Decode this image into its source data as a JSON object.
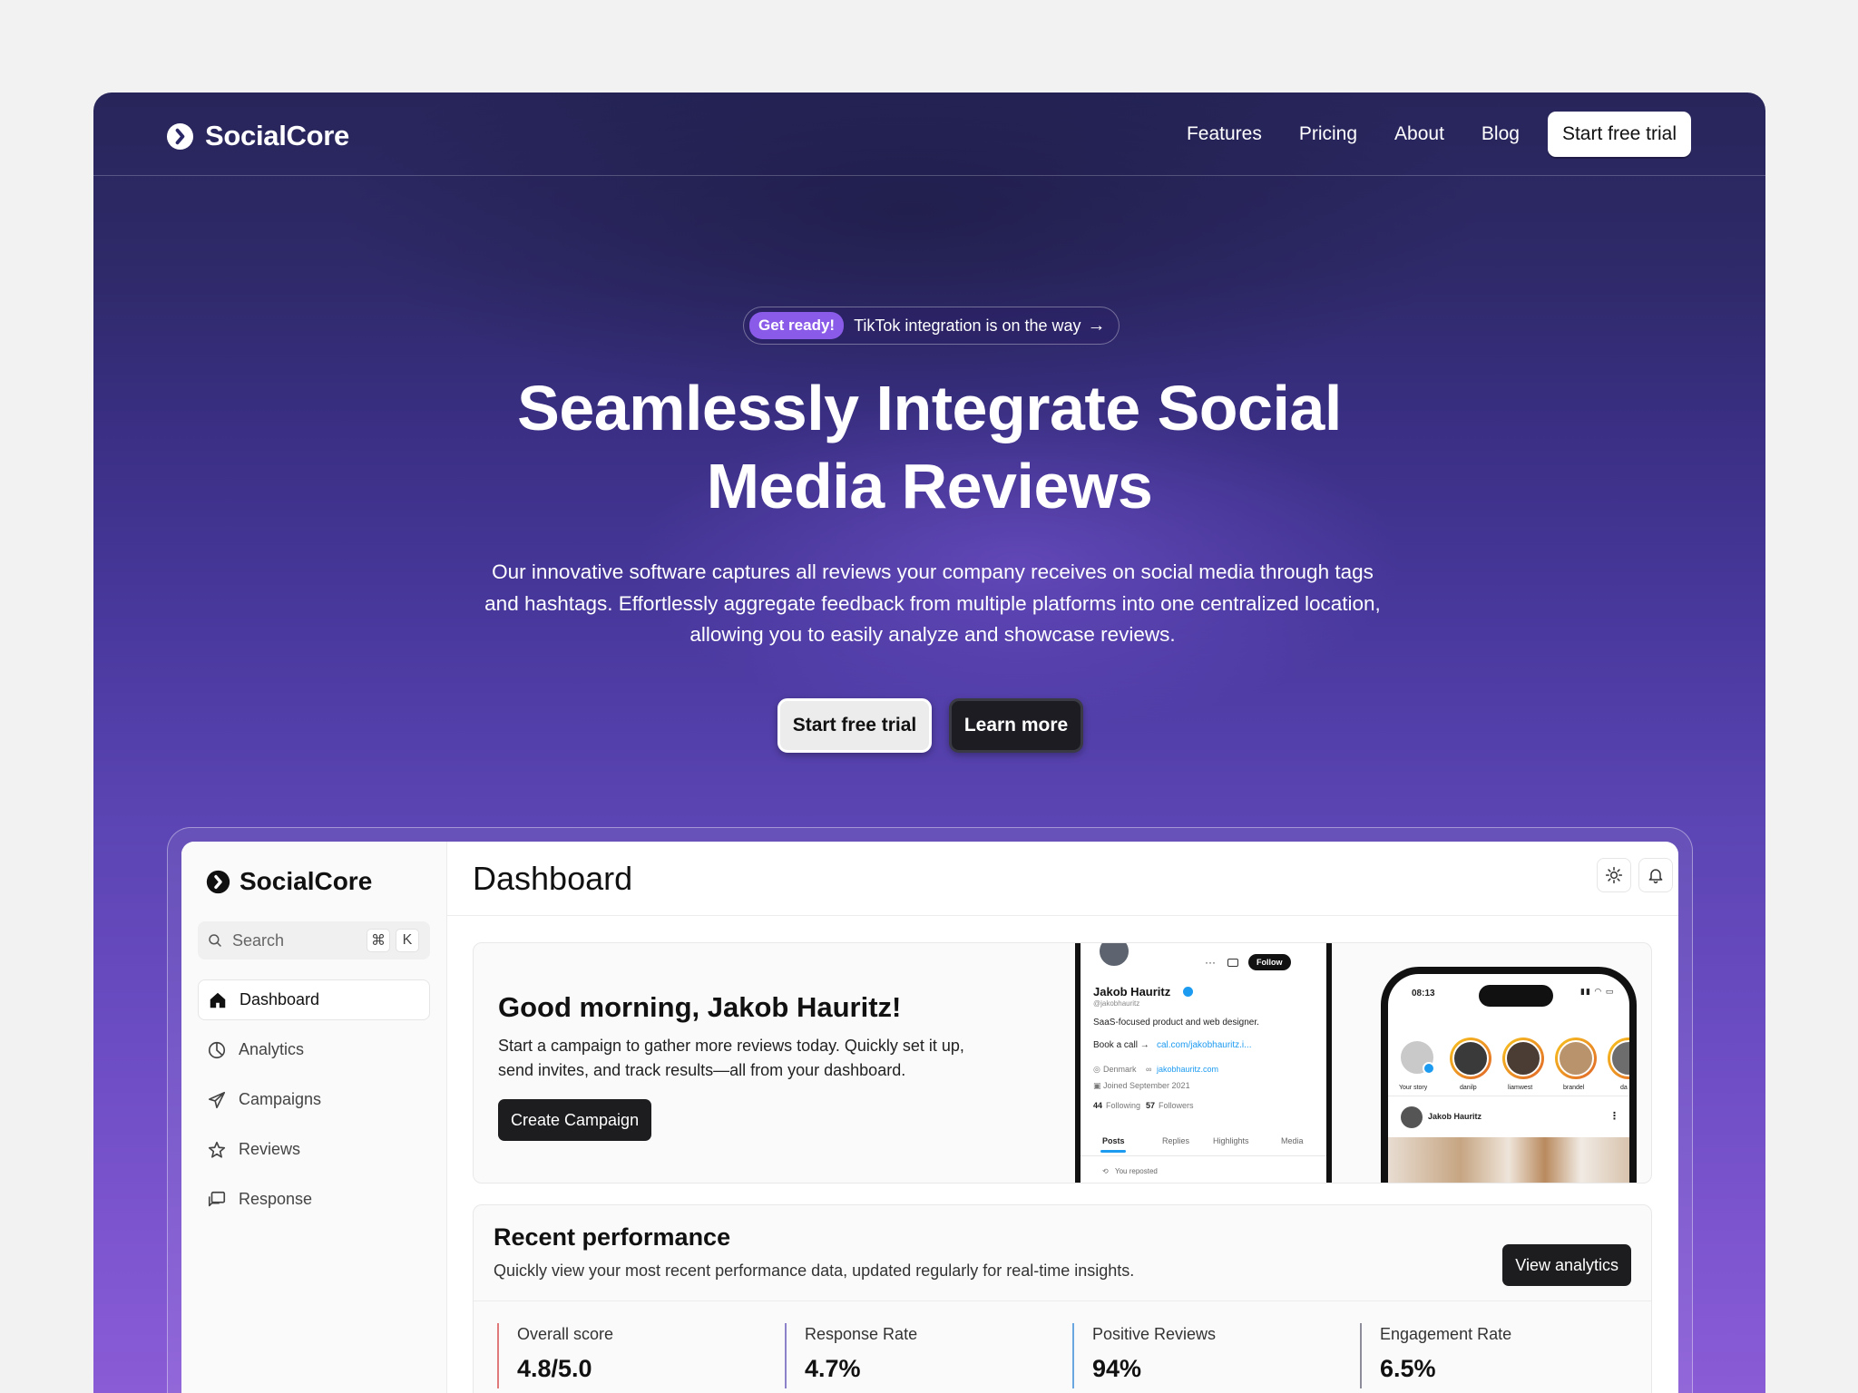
{
  "brand": {
    "name": "SocialCore"
  },
  "nav": {
    "links": [
      "Features",
      "Pricing",
      "About",
      "Blog"
    ],
    "cta": "Start free trial"
  },
  "announcement": {
    "badge": "Get ready!",
    "text": "TikTok integration is on the way",
    "arrow": "→"
  },
  "hero": {
    "title_line1": "Seamlessly Integrate Social",
    "title_line2": "Media Reviews",
    "subtitle": "Our innovative software captures all reviews your company receives on social media through tags and hashtags. Effortlessly aggregate feedback from multiple platforms into one centralized location, allowing you to easily analyze and showcase reviews.",
    "primary_button": "Start free trial",
    "secondary_button": "Learn more"
  },
  "dashboard": {
    "brand": "SocialCore",
    "search": {
      "placeholder": "Search",
      "shortcut_1": "⌘",
      "shortcut_2": "K"
    },
    "menu": [
      {
        "label": "Dashboard",
        "icon": "home-icon",
        "active": true
      },
      {
        "label": "Analytics",
        "icon": "pie-chart-icon"
      },
      {
        "label": "Campaigns",
        "icon": "send-icon"
      },
      {
        "label": "Reviews",
        "icon": "star-icon"
      },
      {
        "label": "Response",
        "icon": "chat-icon"
      }
    ],
    "page_title": "Dashboard",
    "header_icons": [
      "sun-icon",
      "bell-icon"
    ],
    "welcome": {
      "title": "Good morning, Jakob Hauritz!",
      "text": "Start a campaign to gather more reviews today. Quickly set it up, send invites, and track results—all from your dashboard.",
      "button": "Create Campaign"
    },
    "profile_mock": {
      "name": "Jakob Hauritz",
      "handle": "@jakobhauritz",
      "bio": "SaaS-focused product and web designer.",
      "book": "Book a call →",
      "book_link": "cal.com/jakobhauritz.i...",
      "location": "Denmark",
      "site": "jakobhauritz.com",
      "joined": "Joined September 2021",
      "following_count": "44",
      "following_label": "Following",
      "followers_count": "57",
      "followers_label": "Followers",
      "follow_button": "Follow",
      "tabs": [
        "Posts",
        "Replies",
        "Highlights",
        "Media"
      ],
      "reposted": "You reposted"
    },
    "stories_mock": {
      "time": "08:13",
      "stories": [
        "Your story",
        "danilp",
        "liamwest",
        "brandel",
        "da"
      ],
      "post_author": "Jakob Hauritz"
    },
    "performance": {
      "title": "Recent performance",
      "subtitle": "Quickly view your most recent performance data, updated regularly for real-time insights.",
      "button": "View analytics",
      "metrics": [
        {
          "label": "Overall score",
          "value": "4.8/5.0",
          "color": "#e07a7a"
        },
        {
          "label": "Response Rate",
          "value": "4.7%",
          "color": "#8b82c9"
        },
        {
          "label": "Positive Reviews",
          "value": "94%",
          "color": "#6aa6e0"
        },
        {
          "label": "Engagement Rate",
          "value": "6.5%",
          "color": "#8c8c9a"
        }
      ]
    }
  }
}
